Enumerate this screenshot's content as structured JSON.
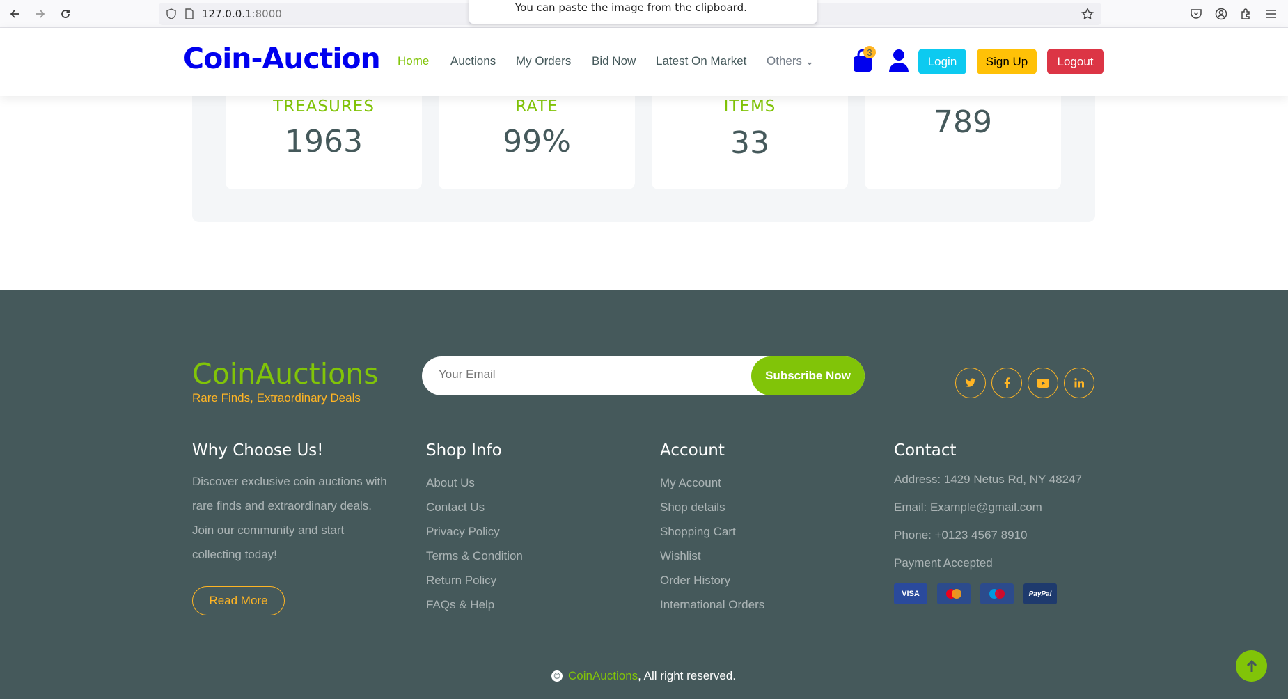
{
  "browser": {
    "url_host": "127.0.0.1",
    "url_port": ":8000",
    "toast": "You can paste the image from the clipboard."
  },
  "header": {
    "logo": "Coin-Auction",
    "nav": [
      "Home",
      "Auctions",
      "My Orders",
      "Bid Now",
      "Latest On Market",
      "Others"
    ],
    "cart_count": "3",
    "login": "Login",
    "signup": "Sign Up",
    "logout": "Logout"
  },
  "stats": [
    {
      "label": "TREASURES",
      "value": "1963"
    },
    {
      "label": "RATE",
      "value": "99%"
    },
    {
      "label": "ITEMS",
      "value": "33"
    },
    {
      "label": "",
      "value": "789"
    }
  ],
  "footer": {
    "brand": "CoinAuctions",
    "tagline": "Rare Finds, Extraordinary Deals",
    "email_placeholder": "Your Email",
    "subscribe": "Subscribe Now",
    "social_icons": [
      "twitter-icon",
      "facebook-icon",
      "youtube-icon",
      "linkedin-icon"
    ],
    "why": {
      "title": "Why Choose Us!",
      "text": "Discover exclusive coin auctions with rare finds and extraordinary deals. Join our community and start collecting today!",
      "button": "Read More"
    },
    "shop_info": {
      "title": "Shop Info",
      "links": [
        "About Us",
        "Contact Us",
        "Privacy Policy",
        "Terms & Condition",
        "Return Policy",
        "FAQs & Help"
      ]
    },
    "account": {
      "title": "Account",
      "links": [
        "My Account",
        "Shop details",
        "Shopping Cart",
        "Wishlist",
        "Order History",
        "International Orders"
      ]
    },
    "contact": {
      "title": "Contact",
      "address": "Address: 1429 Netus Rd, NY 48247",
      "email": "Email: Example@gmail.com",
      "phone": "Phone: +0123 4567 8910",
      "payment": "Payment Accepted",
      "cards": [
        "VISA",
        "mastercard",
        "Maestro",
        "PayPal"
      ]
    },
    "copyright_brand": "CoinAuctions",
    "copyright_text": ", All right reserved."
  },
  "colors": {
    "accent": "#81c408",
    "secondary": "#ffb524",
    "footer_bg": "#45595b",
    "logo": "#0000ee"
  }
}
